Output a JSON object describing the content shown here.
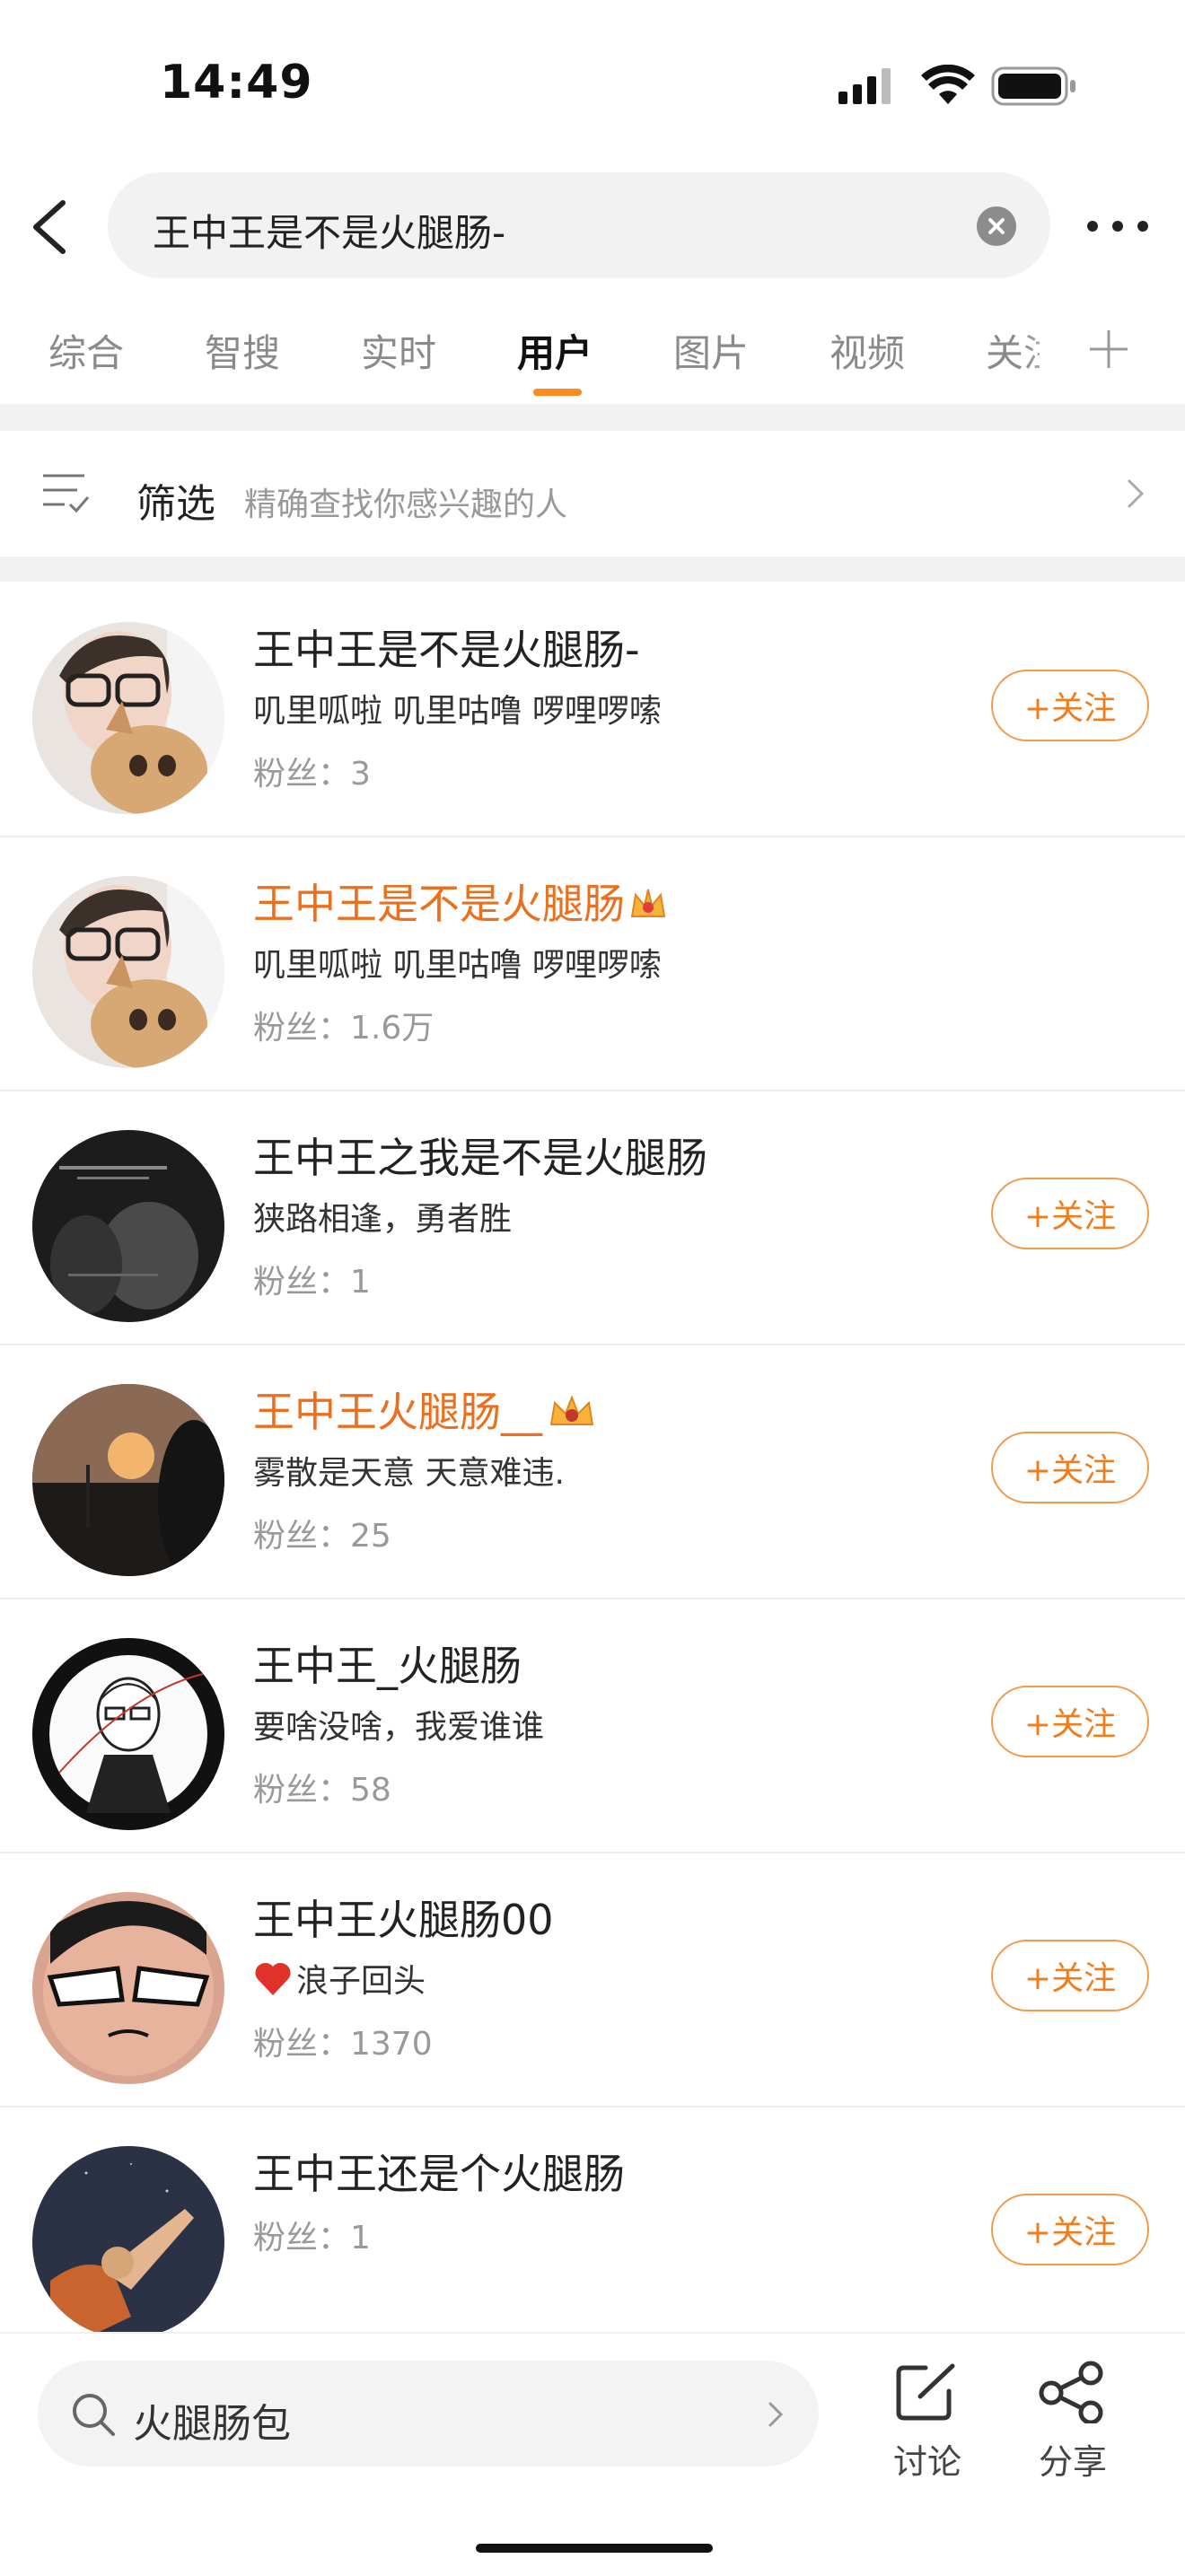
{
  "status_bar": {
    "time": "14:49"
  },
  "search": {
    "query": "王中王是不是火腿肠-"
  },
  "tabs": [
    {
      "label": "综合"
    },
    {
      "label": "智搜"
    },
    {
      "label": "实时"
    },
    {
      "label": "用户"
    },
    {
      "label": "图片"
    },
    {
      "label": "视频"
    },
    {
      "label": "关注"
    }
  ],
  "active_tab": "用户",
  "filter": {
    "title": "筛选",
    "description": "精确查找你感兴趣的人"
  },
  "follow_label": "+关注",
  "users": [
    {
      "name": "王中王是不是火腿肠-",
      "desc": "叽里呱啦 叽里咕噜 啰哩啰嗦",
      "fans": "粉丝：3"
    },
    {
      "name": "王中王是不是火腿肠",
      "desc": "叽里呱啦 叽里咕噜 啰哩啰嗦",
      "fans": "粉丝：1.6万"
    },
    {
      "name": "王中王之我是不是火腿肠",
      "desc": "狭路相逢，勇者胜",
      "fans": "粉丝：1"
    },
    {
      "name": "王中王火腿肠__",
      "desc": "雾散是天意 天意难违.",
      "fans": "粉丝：25"
    },
    {
      "name": "王中王_火腿肠",
      "desc": "要啥没啥，我爱谁谁",
      "fans": "粉丝：58"
    },
    {
      "name": "王中王火腿肠00",
      "desc": "浪子回头",
      "fans": "粉丝：1370"
    },
    {
      "name": "王中王还是个火腿肠",
      "desc": "",
      "fans": "粉丝：1"
    }
  ],
  "bottom": {
    "search_text": "火腿肠包",
    "discuss": "讨论",
    "share": "分享"
  },
  "colors": {
    "accent": "#ef7d1e",
    "vip_name": "#eb6f1d"
  }
}
